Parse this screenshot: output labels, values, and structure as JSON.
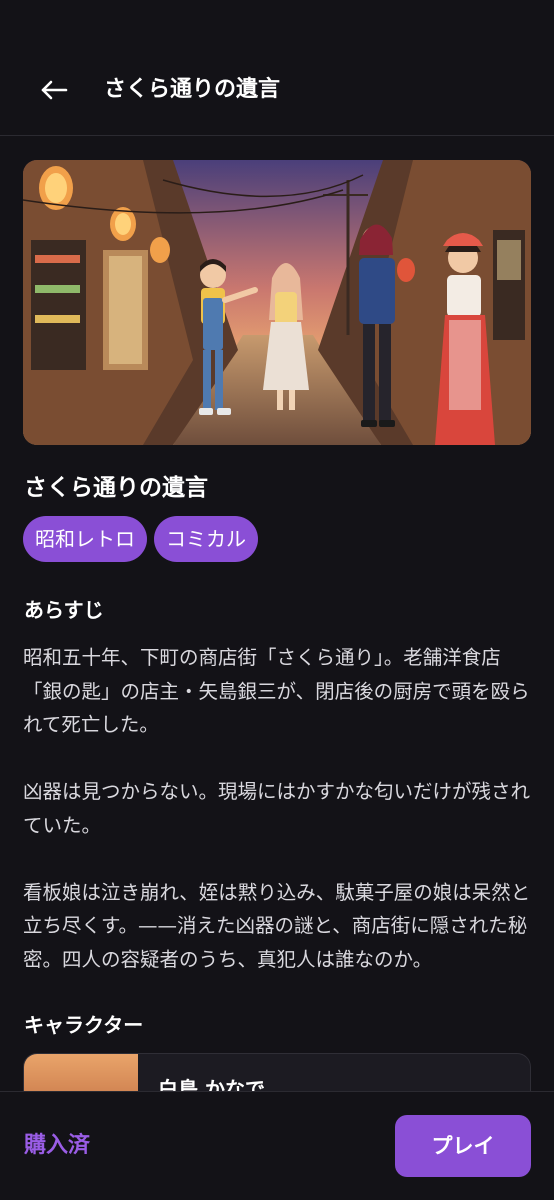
{
  "header": {
    "back_icon": "arrow-left-icon",
    "title": "さくら通りの遺言"
  },
  "story": {
    "title": "さくら通りの遺言",
    "tags": [
      "昭和レトロ",
      "コミカル"
    ],
    "synopsis_heading": "あらすじ",
    "synopsis": [
      "昭和五十年、下町の商店街「さくら通り」。老舗洋食店「銀の匙」の店主・矢島銀三が、閉店後の厨房で頭を殴られて死亡した。",
      "凶器は見つからない。現場にはかすかな匂いだけが残されていた。",
      "看板娘は泣き崩れ、姪は黙り込み、駄菓子屋の娘は呆然と立ち尽くす。——消えた凶器の謎と、商店街に隠された秘密。四人の容疑者のうち、真犯人は誰なのか。"
    ],
    "characters_heading": "キャラクター",
    "characters": [
      {
        "name": "白鳥 かなで"
      }
    ]
  },
  "footer": {
    "status": "購入済",
    "play_label": "プレイ"
  },
  "colors": {
    "background": "#131217",
    "accent": "#8a4fd6",
    "accent_text": "#9a5de6"
  }
}
